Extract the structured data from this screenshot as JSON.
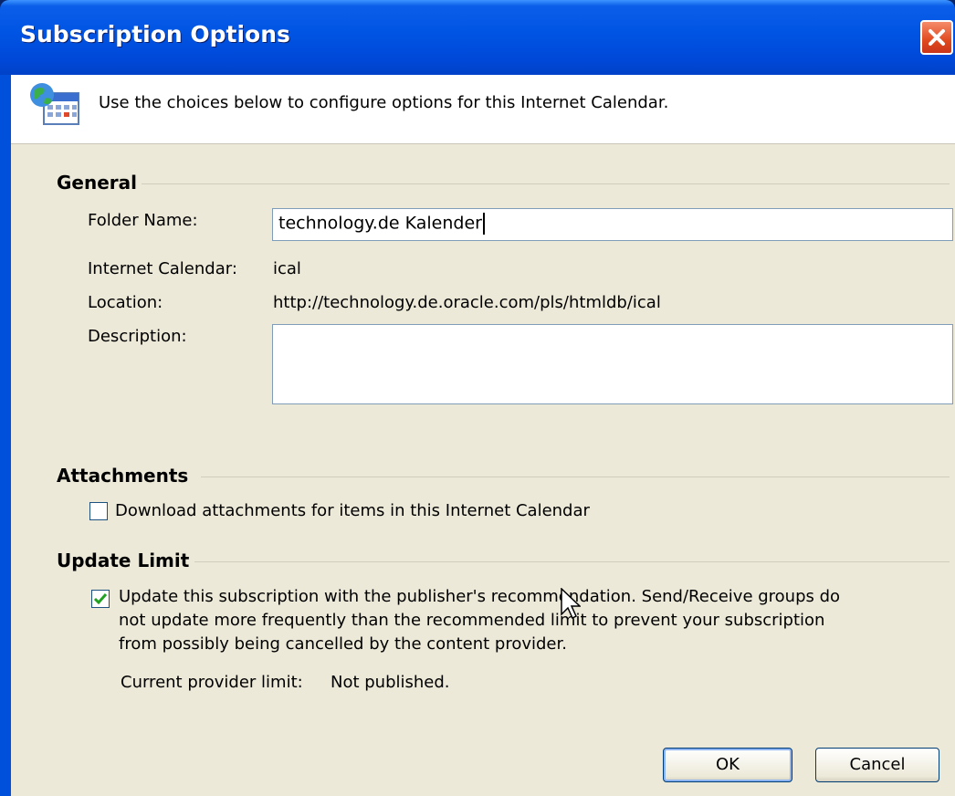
{
  "window": {
    "title": "Subscription Options"
  },
  "header": {
    "text": "Use the choices below to configure options for this Internet Calendar."
  },
  "general": {
    "heading": "General",
    "folder_name_label": "Folder Name:",
    "folder_name_value": "technology.de Kalender",
    "internet_calendar_label": "Internet Calendar:",
    "internet_calendar_value": "ical",
    "location_label": "Location:",
    "location_value": "http://technology.de.oracle.com/pls/htmldb/ical",
    "description_label": "Description:",
    "description_value": ""
  },
  "attachments": {
    "heading": "Attachments",
    "download_label": "Download attachments for items in this Internet Calendar",
    "download_checked": false
  },
  "update_limit": {
    "heading": "Update Limit",
    "update_line1": "Update this subscription with the publisher's recommendation. Send/Receive groups do",
    "update_line2": "not update more frequently than the recommended limit to prevent your subscription",
    "update_line3": "from possibly being cancelled by the content provider.",
    "update_checked": true,
    "provider_limit_label": "Current provider limit:",
    "provider_limit_value": "Not published."
  },
  "buttons": {
    "ok": "OK",
    "cancel": "Cancel"
  },
  "colors": {
    "title_bar": "#0054e3",
    "dialog_bg": "#ece9d8",
    "close_button": "#e04a1f",
    "check_mark": "#21a121"
  },
  "icons": {
    "header": "internet-calendar-icon",
    "close": "close-icon",
    "check": "check-icon",
    "pointer": "mouse-pointer-icon"
  }
}
